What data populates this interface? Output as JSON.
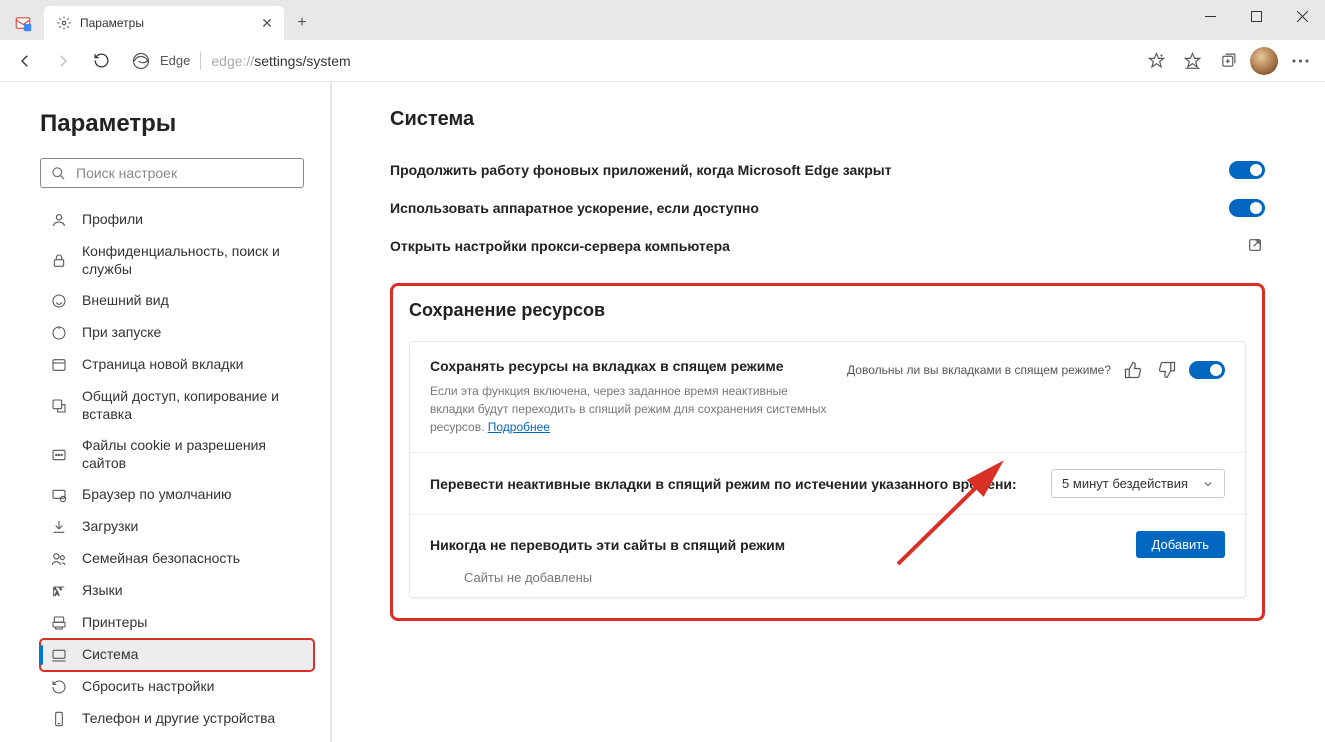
{
  "tab": {
    "title": "Параметры"
  },
  "toolbar": {
    "brand": "Edge",
    "url_proto": "edge://",
    "url_path": "settings/system"
  },
  "sidebar": {
    "title": "Параметры",
    "search_placeholder": "Поиск настроек",
    "items": [
      {
        "label": "Профили"
      },
      {
        "label": "Конфиденциальность, поиск и службы"
      },
      {
        "label": "Внешний вид"
      },
      {
        "label": "При запуске"
      },
      {
        "label": "Страница новой вкладки"
      },
      {
        "label": "Общий доступ, копирование и вставка"
      },
      {
        "label": "Файлы cookie и разрешения сайтов"
      },
      {
        "label": "Браузер по умолчанию"
      },
      {
        "label": "Загрузки"
      },
      {
        "label": "Семейная безопасность"
      },
      {
        "label": "Языки"
      },
      {
        "label": "Принтеры"
      },
      {
        "label": "Система"
      },
      {
        "label": "Сбросить настройки"
      },
      {
        "label": "Телефон и другие устройства"
      }
    ]
  },
  "system": {
    "heading": "Система",
    "bg_apps": "Продолжить работу фоновых приложений, когда Microsoft Edge закрыт",
    "hw_accel": "Использовать аппаратное ускорение, если доступно",
    "proxy": "Открыть настройки прокси-сервера компьютера"
  },
  "resources": {
    "heading": "Сохранение ресурсов",
    "sleep_title": "Сохранять ресурсы на вкладках в спящем режиме",
    "sleep_desc": "Если эта функция включена, через заданное время неактивные вкладки будут переходить в спящий режим для сохранения системных ресурсов. ",
    "sleep_more": "Подробнее",
    "feedback_q": "Довольны ли вы вкладками в спящем режиме?",
    "timeout_label": "Перевести неактивные вкладки в спящий режим по истечении указанного времени:",
    "timeout_value": "5 минут бездействия",
    "never_label": "Никогда не переводить эти сайты в спящий режим",
    "add_button": "Добавить",
    "no_sites": "Сайты не добавлены"
  }
}
